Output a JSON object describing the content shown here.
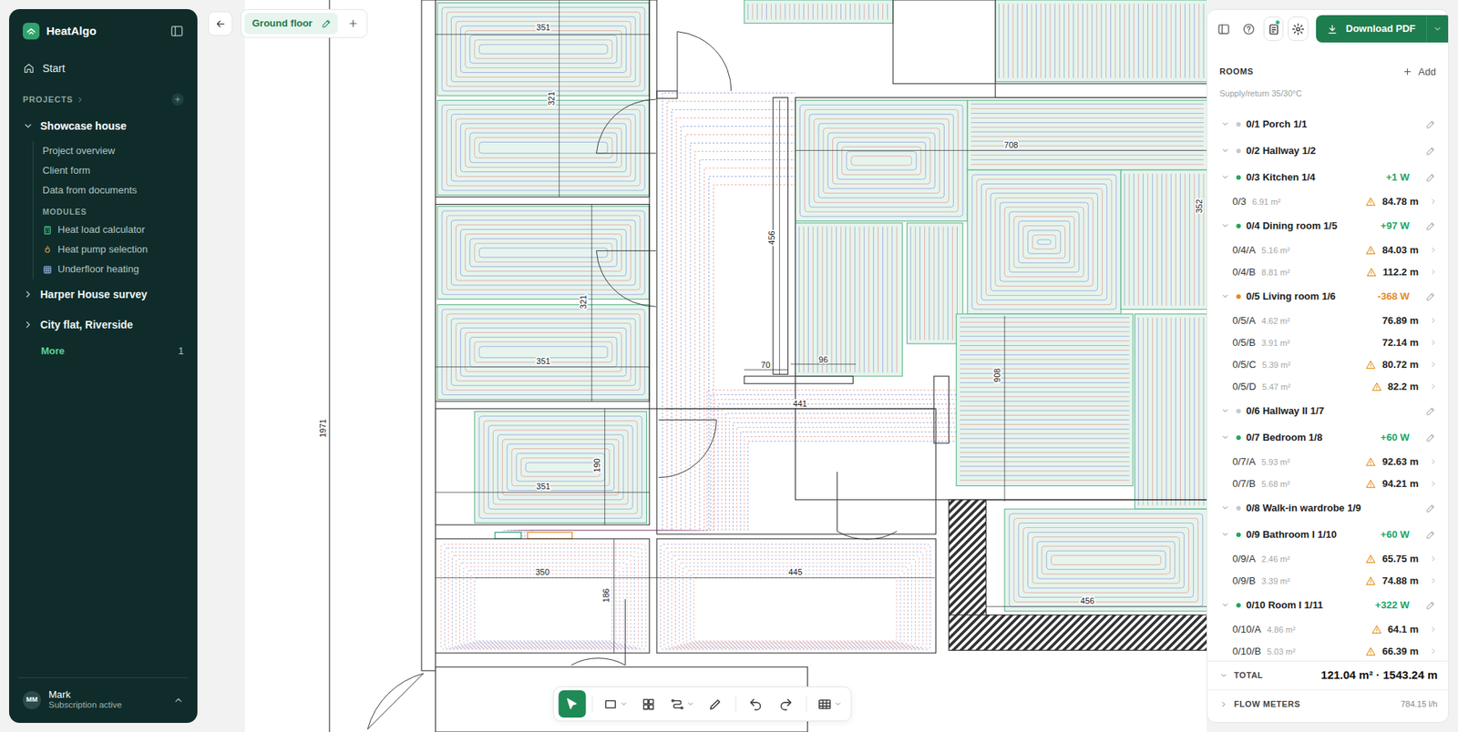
{
  "app": {
    "name": "HeatAlgo"
  },
  "sidebar": {
    "nav": [
      {
        "label": "Start"
      }
    ],
    "projects_label": "PROJECTS",
    "projects": [
      {
        "name": "Showcase house",
        "expanded": true,
        "items": [
          {
            "label": "Project overview"
          },
          {
            "label": "Client form"
          },
          {
            "label": "Data from documents"
          }
        ],
        "modules_label": "MODULES",
        "modules": [
          {
            "label": "Heat load calculator",
            "kind": "calculator"
          },
          {
            "label": "Heat pump selection",
            "kind": "pump"
          },
          {
            "label": "Underfloor heating",
            "kind": "floor"
          }
        ]
      },
      {
        "name": "Harper House survey",
        "expanded": false
      },
      {
        "name": "City flat, Riverside",
        "expanded": false
      }
    ],
    "more": {
      "label": "More",
      "count": "1"
    },
    "user": {
      "initials": "MM",
      "name": "Mark",
      "status": "Subscription active"
    }
  },
  "floor_tab": {
    "label": "Ground floor",
    "selected": true
  },
  "toolbar": [
    {
      "kind": "select",
      "selected": true,
      "has_menu": false
    },
    {
      "kind": "rectangle",
      "selected": false,
      "has_menu": true
    },
    {
      "kind": "grid",
      "selected": false,
      "has_menu": false
    },
    {
      "kind": "route",
      "selected": false,
      "has_menu": true
    },
    {
      "kind": "pen",
      "selected": false,
      "has_menu": false
    },
    {
      "kind": "undo",
      "selected": false,
      "has_menu": false
    },
    {
      "kind": "redo",
      "selected": false,
      "has_menu": false
    },
    {
      "kind": "table",
      "selected": false,
      "has_menu": true
    }
  ],
  "panel": {
    "header_buttons": [
      {
        "kind": "sidebar",
        "selected": false,
        "badge": false
      },
      {
        "kind": "help",
        "selected": false,
        "badge": false
      },
      {
        "kind": "notes",
        "selected": true,
        "badge": true
      },
      {
        "kind": "settings",
        "selected": true,
        "badge": false
      }
    ],
    "download": "Download PDF",
    "rooms_title": "ROOMS",
    "add": "Add",
    "subtitle": "Supply/return 35/30°C",
    "rooms": [
      {
        "name": "0/1 Porch 1/1",
        "expanded": true,
        "color": "#c5cac8",
        "circuits": []
      },
      {
        "name": "0/2 Hallway 1/2",
        "expanded": true,
        "color": "#c5cac8",
        "circuits": []
      },
      {
        "name": "0/3 Kitchen 1/4",
        "expanded": true,
        "color": "#22a463",
        "delta": "+1 W",
        "circuits": [
          {
            "name": "0/3",
            "area": "6.91 m²",
            "length": "84.78 m",
            "warning": true
          }
        ]
      },
      {
        "name": "0/4 Dining room 1/5",
        "expanded": true,
        "color": "#22a463",
        "delta": "+97 W",
        "circuits": [
          {
            "name": "0/4/A",
            "area": "5.16 m²",
            "length": "84.03 m",
            "warning": true
          },
          {
            "name": "0/4/B",
            "area": "8.81 m²",
            "length": "112.2 m",
            "warning": true
          }
        ]
      },
      {
        "name": "0/5 Living room 1/6",
        "expanded": true,
        "color": "#e58a1f",
        "delta": "-368 W",
        "circuits": [
          {
            "name": "0/5/A",
            "area": "4.62 m²",
            "length": "76.89 m",
            "warning": false
          },
          {
            "name": "0/5/B",
            "area": "3.91 m²",
            "length": "72.14 m",
            "warning": false
          },
          {
            "name": "0/5/C",
            "area": "5.39 m²",
            "length": "80.72 m",
            "warning": true
          },
          {
            "name": "0/5/D",
            "area": "5.47 m²",
            "length": "82.2 m",
            "warning": true
          }
        ]
      },
      {
        "name": "0/6 Hallway II 1/7",
        "expanded": true,
        "color": "#c5cac8",
        "circuits": []
      },
      {
        "name": "0/7 Bedroom 1/8",
        "expanded": true,
        "color": "#22a463",
        "delta": "+60 W",
        "circuits": [
          {
            "name": "0/7/A",
            "area": "5.93 m²",
            "length": "92.63 m",
            "warning": true
          },
          {
            "name": "0/7/B",
            "area": "5.68 m²",
            "length": "94.21 m",
            "warning": true
          }
        ]
      },
      {
        "name": "0/8 Walk-in wardrobe 1/9",
        "expanded": true,
        "color": "#c5cac8",
        "circuits": []
      },
      {
        "name": "0/9 Bathroom I 1/10",
        "expanded": true,
        "color": "#22a463",
        "delta": "+60 W",
        "circuits": [
          {
            "name": "0/9/A",
            "area": "2.46 m²",
            "length": "65.75 m",
            "warning": true
          },
          {
            "name": "0/9/B",
            "area": "3.39 m²",
            "length": "74.88 m",
            "warning": true
          }
        ]
      },
      {
        "name": "0/10 Room I 1/11",
        "expanded": true,
        "color": "#22a463",
        "delta": "+322 W",
        "circuits": [
          {
            "name": "0/10/A",
            "area": "4.86 m²",
            "length": "64.1 m",
            "warning": true
          },
          {
            "name": "0/10/B",
            "area": "5.03 m²",
            "length": "66.39 m",
            "warning": true
          }
        ]
      }
    ],
    "total": {
      "label": "TOTAL",
      "value": "121.04 m² · 1543.24 m",
      "expanded": false
    },
    "flow_meters": {
      "label": "FLOW METERS",
      "value": "784.15 l/h",
      "expanded": false
    }
  },
  "plan": {
    "dimensions": [
      {
        "text": "351"
      },
      {
        "text": "321"
      },
      {
        "text": "321"
      },
      {
        "text": "351"
      },
      {
        "text": "351"
      },
      {
        "text": "190"
      },
      {
        "text": "350"
      },
      {
        "text": "186"
      },
      {
        "text": "445"
      },
      {
        "text": "441"
      },
      {
        "text": "456"
      },
      {
        "text": "70"
      },
      {
        "text": "96"
      },
      {
        "text": "708"
      },
      {
        "text": "908"
      },
      {
        "text": "456"
      },
      {
        "text": "1971"
      },
      {
        "text": "352"
      }
    ]
  }
}
